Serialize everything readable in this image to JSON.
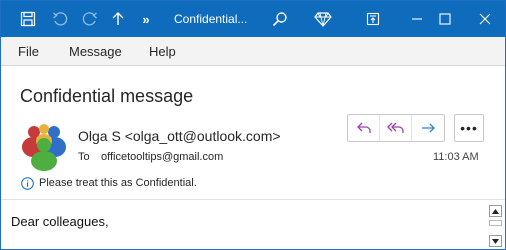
{
  "titlebar": {
    "title": "Confidential...",
    "overflow_label": "»"
  },
  "menu": {
    "items": [
      "File",
      "Message",
      "Help"
    ]
  },
  "message": {
    "subject": "Confidential message",
    "sender": "Olga S <olga_ott@outlook.com>",
    "to_label": "To",
    "to_value": "officetooltips@gmail.com",
    "time": "11:03 AM",
    "info": "Please treat this as Confidential.",
    "body": "Dear colleagues,"
  },
  "actions": {
    "more": "•••"
  },
  "colors": {
    "titlebar": "#0f6cbd",
    "accent_purple": "#a33db0",
    "accent_blue": "#2b88d8",
    "info_blue": "#0f6cbd"
  },
  "icons": [
    "save-icon",
    "undo-icon",
    "redo-icon",
    "up-arrow-icon",
    "search-icon",
    "diamond-icon",
    "restore-icon",
    "minimize-icon",
    "maximize-icon",
    "close-icon",
    "reply-icon",
    "reply-all-icon",
    "forward-icon",
    "info-icon"
  ]
}
